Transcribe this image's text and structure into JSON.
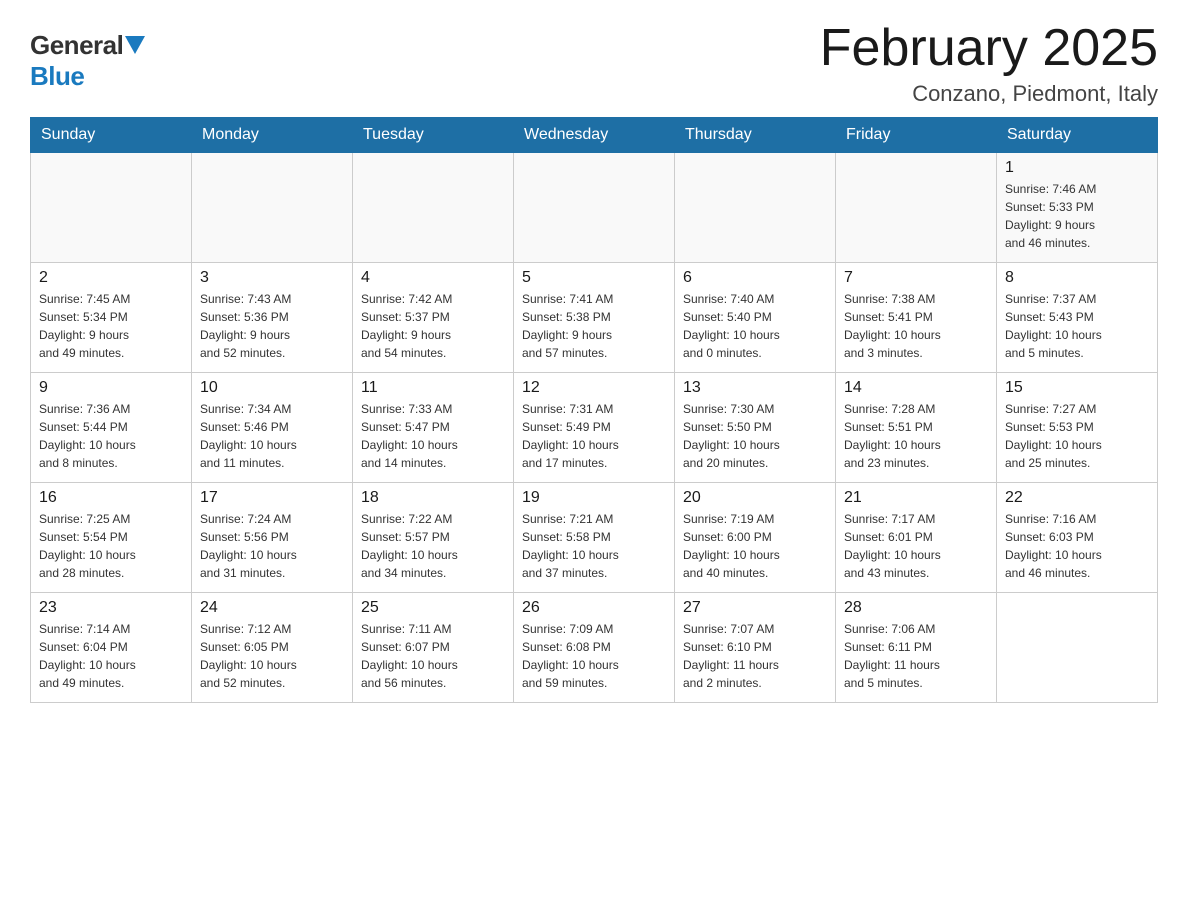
{
  "logo": {
    "general": "General",
    "blue": "Blue"
  },
  "title": "February 2025",
  "location": "Conzano, Piedmont, Italy",
  "weekdays": [
    "Sunday",
    "Monday",
    "Tuesday",
    "Wednesday",
    "Thursday",
    "Friday",
    "Saturday"
  ],
  "weeks": [
    [
      {
        "day": "",
        "info": ""
      },
      {
        "day": "",
        "info": ""
      },
      {
        "day": "",
        "info": ""
      },
      {
        "day": "",
        "info": ""
      },
      {
        "day": "",
        "info": ""
      },
      {
        "day": "",
        "info": ""
      },
      {
        "day": "1",
        "info": "Sunrise: 7:46 AM\nSunset: 5:33 PM\nDaylight: 9 hours\nand 46 minutes."
      }
    ],
    [
      {
        "day": "2",
        "info": "Sunrise: 7:45 AM\nSunset: 5:34 PM\nDaylight: 9 hours\nand 49 minutes."
      },
      {
        "day": "3",
        "info": "Sunrise: 7:43 AM\nSunset: 5:36 PM\nDaylight: 9 hours\nand 52 minutes."
      },
      {
        "day": "4",
        "info": "Sunrise: 7:42 AM\nSunset: 5:37 PM\nDaylight: 9 hours\nand 54 minutes."
      },
      {
        "day": "5",
        "info": "Sunrise: 7:41 AM\nSunset: 5:38 PM\nDaylight: 9 hours\nand 57 minutes."
      },
      {
        "day": "6",
        "info": "Sunrise: 7:40 AM\nSunset: 5:40 PM\nDaylight: 10 hours\nand 0 minutes."
      },
      {
        "day": "7",
        "info": "Sunrise: 7:38 AM\nSunset: 5:41 PM\nDaylight: 10 hours\nand 3 minutes."
      },
      {
        "day": "8",
        "info": "Sunrise: 7:37 AM\nSunset: 5:43 PM\nDaylight: 10 hours\nand 5 minutes."
      }
    ],
    [
      {
        "day": "9",
        "info": "Sunrise: 7:36 AM\nSunset: 5:44 PM\nDaylight: 10 hours\nand 8 minutes."
      },
      {
        "day": "10",
        "info": "Sunrise: 7:34 AM\nSunset: 5:46 PM\nDaylight: 10 hours\nand 11 minutes."
      },
      {
        "day": "11",
        "info": "Sunrise: 7:33 AM\nSunset: 5:47 PM\nDaylight: 10 hours\nand 14 minutes."
      },
      {
        "day": "12",
        "info": "Sunrise: 7:31 AM\nSunset: 5:49 PM\nDaylight: 10 hours\nand 17 minutes."
      },
      {
        "day": "13",
        "info": "Sunrise: 7:30 AM\nSunset: 5:50 PM\nDaylight: 10 hours\nand 20 minutes."
      },
      {
        "day": "14",
        "info": "Sunrise: 7:28 AM\nSunset: 5:51 PM\nDaylight: 10 hours\nand 23 minutes."
      },
      {
        "day": "15",
        "info": "Sunrise: 7:27 AM\nSunset: 5:53 PM\nDaylight: 10 hours\nand 25 minutes."
      }
    ],
    [
      {
        "day": "16",
        "info": "Sunrise: 7:25 AM\nSunset: 5:54 PM\nDaylight: 10 hours\nand 28 minutes."
      },
      {
        "day": "17",
        "info": "Sunrise: 7:24 AM\nSunset: 5:56 PM\nDaylight: 10 hours\nand 31 minutes."
      },
      {
        "day": "18",
        "info": "Sunrise: 7:22 AM\nSunset: 5:57 PM\nDaylight: 10 hours\nand 34 minutes."
      },
      {
        "day": "19",
        "info": "Sunrise: 7:21 AM\nSunset: 5:58 PM\nDaylight: 10 hours\nand 37 minutes."
      },
      {
        "day": "20",
        "info": "Sunrise: 7:19 AM\nSunset: 6:00 PM\nDaylight: 10 hours\nand 40 minutes."
      },
      {
        "day": "21",
        "info": "Sunrise: 7:17 AM\nSunset: 6:01 PM\nDaylight: 10 hours\nand 43 minutes."
      },
      {
        "day": "22",
        "info": "Sunrise: 7:16 AM\nSunset: 6:03 PM\nDaylight: 10 hours\nand 46 minutes."
      }
    ],
    [
      {
        "day": "23",
        "info": "Sunrise: 7:14 AM\nSunset: 6:04 PM\nDaylight: 10 hours\nand 49 minutes."
      },
      {
        "day": "24",
        "info": "Sunrise: 7:12 AM\nSunset: 6:05 PM\nDaylight: 10 hours\nand 52 minutes."
      },
      {
        "day": "25",
        "info": "Sunrise: 7:11 AM\nSunset: 6:07 PM\nDaylight: 10 hours\nand 56 minutes."
      },
      {
        "day": "26",
        "info": "Sunrise: 7:09 AM\nSunset: 6:08 PM\nDaylight: 10 hours\nand 59 minutes."
      },
      {
        "day": "27",
        "info": "Sunrise: 7:07 AM\nSunset: 6:10 PM\nDaylight: 11 hours\nand 2 minutes."
      },
      {
        "day": "28",
        "info": "Sunrise: 7:06 AM\nSunset: 6:11 PM\nDaylight: 11 hours\nand 5 minutes."
      },
      {
        "day": "",
        "info": ""
      }
    ]
  ]
}
